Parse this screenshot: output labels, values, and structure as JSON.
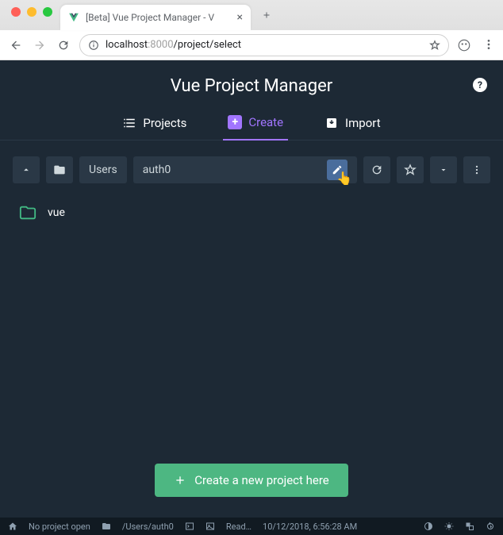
{
  "browser": {
    "tab_title": "[Beta] Vue Project Manager - V",
    "url_host": "localhost",
    "url_port": ":8000",
    "url_path": "/project/select"
  },
  "app": {
    "title": "Vue Project Manager",
    "tabs": {
      "projects": "Projects",
      "create": "Create",
      "import": "Import"
    },
    "breadcrumb": {
      "segment1": "Users",
      "current": "auth0"
    },
    "files": [
      {
        "name": "vue"
      }
    ],
    "create_button": "Create a new project here"
  },
  "statusbar": {
    "no_project": "No project open",
    "path": "/Users/auth0",
    "ready": "Read…",
    "timestamp": "10/12/2018, 6:56:28 AM"
  }
}
